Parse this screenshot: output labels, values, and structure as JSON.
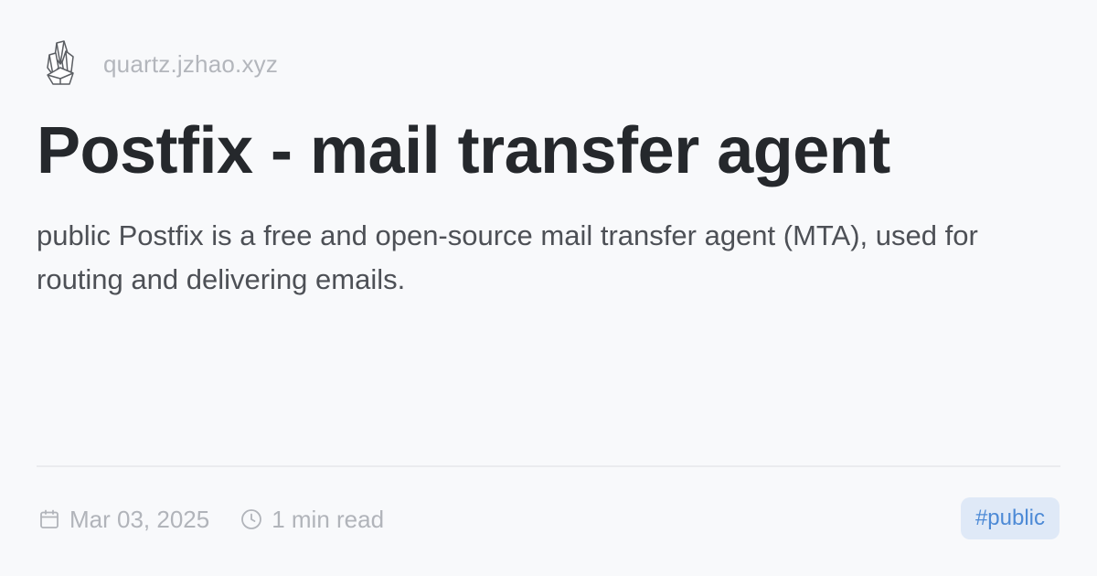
{
  "site": {
    "logo_icon": "crystal-icon",
    "domain": "quartz.jzhao.xyz"
  },
  "page": {
    "title": "Postfix - mail transfer agent",
    "description": "public Postfix is a free and open-source mail transfer agent (MTA), used for routing and delivering emails."
  },
  "meta": {
    "date_icon": "calendar-icon",
    "date": "Mar 03, 2025",
    "reading_time_icon": "clock-icon",
    "reading_time": "1 min read"
  },
  "tags": [
    {
      "label": "#public"
    }
  ],
  "colors": {
    "background": "#f8f9fb",
    "title": "#25282c",
    "body_text": "#4d5056",
    "muted_text": "#b3b6bc",
    "tag_bg": "#dfe9f7",
    "tag_text": "#4d8ad6"
  }
}
